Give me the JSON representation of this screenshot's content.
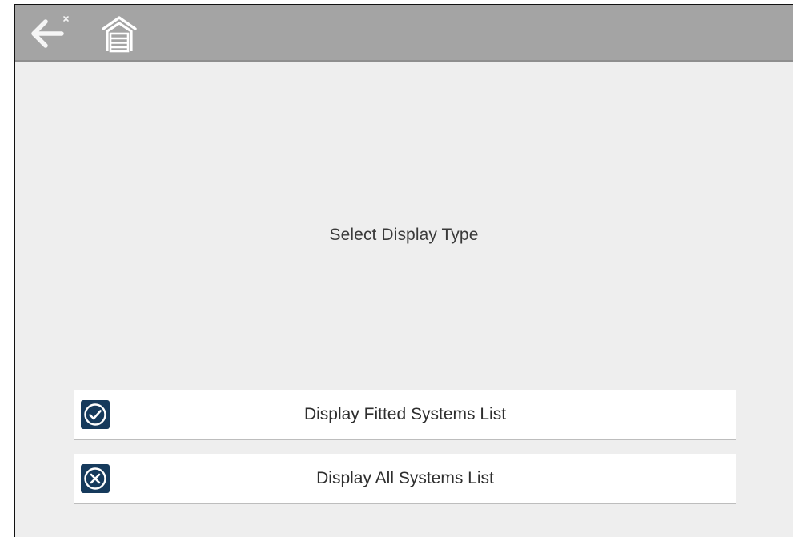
{
  "toolbar": {
    "back_button": {
      "icon": "back-arrow-icon",
      "color": "#f5f5f5"
    },
    "home_button": {
      "icon": "garage-home-icon",
      "color": "#ffffff"
    },
    "background_color": "#a4a4a4"
  },
  "main": {
    "prompt": "Select Display Type",
    "background_color": "#eeeeee"
  },
  "options": [
    {
      "label": "Display Fitted Systems List",
      "icon": "check-circle-icon",
      "icon_bg": "#163a5c"
    },
    {
      "label": "Display All Systems List",
      "icon": "x-circle-icon",
      "icon_bg": "#163a5c"
    }
  ]
}
